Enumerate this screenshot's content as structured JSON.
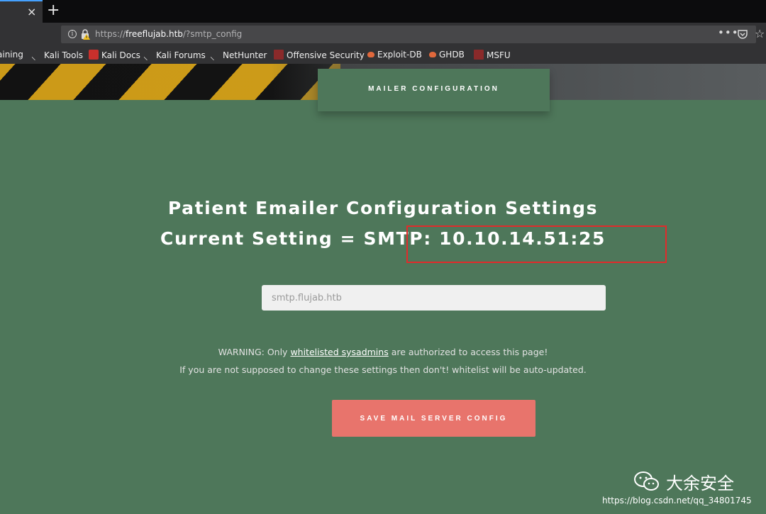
{
  "browser": {
    "tab_close": "×",
    "tab_new": "+",
    "url_prefix": "https://",
    "url_host": "freeflujab.htb",
    "url_path": "/?smtp_config",
    "url_menu": "•••"
  },
  "bookmarks": [
    {
      "label": "aining"
    },
    {
      "label": "Kali Tools"
    },
    {
      "label": "Kali Docs"
    },
    {
      "label": "Kali Forums"
    },
    {
      "label": "NetHunter"
    },
    {
      "label": "Offensive Security"
    },
    {
      "label": "Exploit-DB"
    },
    {
      "label": "GHDB"
    },
    {
      "label": "MSFU"
    }
  ],
  "page": {
    "tab_label": "MAILER CONFIGURATION",
    "title_line1": "Patient Emailer Configuration Settings",
    "title_line2": "Current Setting = SMTP: 10.10.14.51:25",
    "input_placeholder": "smtp.flujab.htb",
    "warning_prefix": "WARNING: Only ",
    "warning_link": "whitelisted sysadmins",
    "warning_suffix": " are authorized to access this page!",
    "warning_line2": "If you are not supposed to change these settings then don't! whitelist will be auto-updated.",
    "save_button": "SAVE MAIL SERVER CONFIG"
  },
  "watermark": {
    "brand": "大余安全",
    "url": "https://blog.csdn.net/qq_34801745"
  },
  "colors": {
    "page_bg": "#4e775a",
    "button": "#e8746c",
    "highlight_box": "#e12b2b"
  }
}
